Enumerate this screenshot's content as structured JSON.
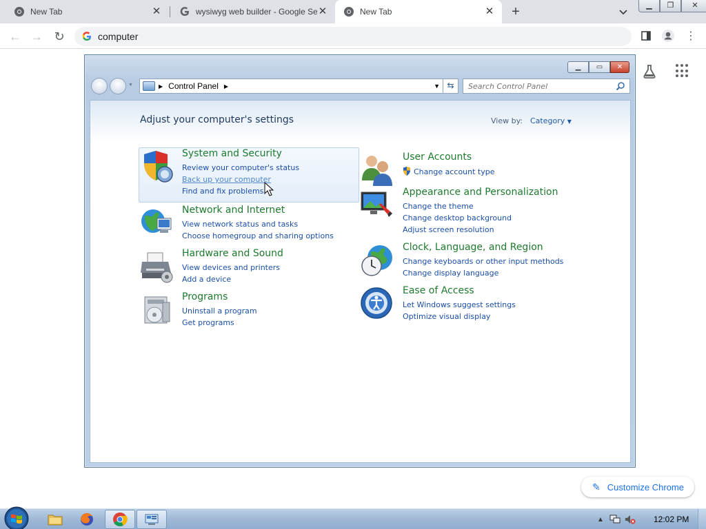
{
  "browser": {
    "tabs": [
      {
        "title": "New Tab",
        "active": false
      },
      {
        "title": "wysiwyg web builder - Google Se",
        "active": false
      },
      {
        "title": "New Tab",
        "active": true
      }
    ],
    "new_tab_symbol": "+",
    "omnibox": {
      "value": "computer"
    },
    "icons": {
      "back": "back-arrow-icon",
      "forward": "forward-arrow-icon",
      "reload": "reload-icon",
      "side_panel": "side-panel-icon",
      "profile": "profile-icon",
      "menu": "more-vert-icon",
      "labs": "labs-flask-icon",
      "apps": "google-apps-icon"
    },
    "customize_label": "Customize Chrome"
  },
  "control_panel": {
    "breadcrumb": "Control Panel",
    "search_placeholder": "Search Control Panel",
    "heading": "Adjust your computer's settings",
    "view_by_label": "View by:",
    "view_by_value": "Category",
    "left_categories": [
      {
        "title": "System and Security",
        "icon": "shield-icon",
        "links": [
          "Review your computer's status",
          "Back up your computer",
          "Find and fix problems"
        ]
      },
      {
        "title": "Network and Internet",
        "icon": "network-globe-icon",
        "links": [
          "View network status and tasks",
          "Choose homegroup and sharing options"
        ]
      },
      {
        "title": "Hardware and Sound",
        "icon": "printer-icon",
        "links": [
          "View devices and printers",
          "Add a device"
        ]
      },
      {
        "title": "Programs",
        "icon": "programs-disc-icon",
        "links": [
          "Uninstall a program",
          "Get programs"
        ]
      }
    ],
    "right_categories": [
      {
        "title": "User Accounts",
        "icon": "users-icon",
        "links": [
          "Change account type"
        ]
      },
      {
        "title": "Appearance and Personalization",
        "icon": "monitor-paint-icon",
        "links": [
          "Change the theme",
          "Change desktop background",
          "Adjust screen resolution"
        ]
      },
      {
        "title": "Clock, Language, and Region",
        "icon": "clock-globe-icon",
        "links": [
          "Change keyboards or other input methods",
          "Change display language"
        ]
      },
      {
        "title": "Ease of Access",
        "icon": "ease-of-access-icon",
        "links": [
          "Let Windows suggest settings",
          "Optimize visual display"
        ]
      }
    ]
  },
  "taskbar": {
    "clock": "12:02 PM",
    "items": [
      "file-explorer-icon",
      "firefox-icon",
      "chrome-icon",
      "control-panel-icon"
    ]
  }
}
